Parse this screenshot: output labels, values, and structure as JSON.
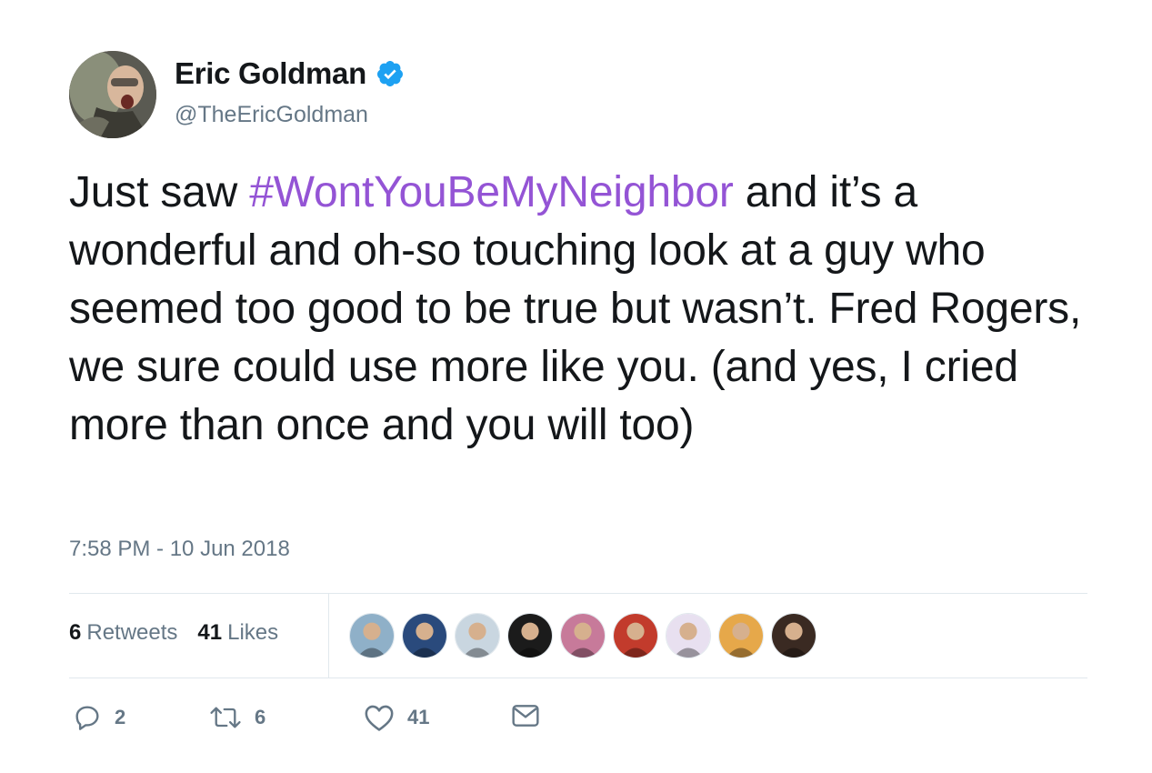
{
  "author": {
    "display_name": "Eric Goldman",
    "handle": "@TheEricGoldman",
    "verified": true,
    "avatar_icon": "user-avatar"
  },
  "tweet": {
    "text_before": "Just saw ",
    "hashtag": "#WontYouBeMyNeighbor",
    "text_after": " and it’s a wonderful and oh-so touching look at a guy who seemed too good to be true but wasn’t. Fred Rogers, we sure could use more like you. (and yes, I cried more than once and you will too)",
    "timestamp": "7:58 PM - 10 Jun 2018"
  },
  "stats": {
    "retweets_count": "6",
    "retweets_label": "Retweets",
    "likes_count": "41",
    "likes_label": "Likes"
  },
  "likers": [
    {
      "icon": "liker-avatar-1",
      "color": "#8fb0c8"
    },
    {
      "icon": "liker-avatar-2",
      "color": "#2a4a7c"
    },
    {
      "icon": "liker-avatar-3",
      "color": "#c9d6e0"
    },
    {
      "icon": "liker-avatar-4",
      "color": "#1b1b1b"
    },
    {
      "icon": "liker-avatar-5",
      "color": "#c77a9a"
    },
    {
      "icon": "liker-avatar-6",
      "color": "#c23b2c"
    },
    {
      "icon": "liker-avatar-7",
      "color": "#e8e0f0"
    },
    {
      "icon": "liker-avatar-8",
      "color": "#e6a84a"
    },
    {
      "icon": "liker-avatar-9",
      "color": "#3a2a22"
    }
  ],
  "actions": {
    "reply_count": "2",
    "retweet_count": "6",
    "like_count": "41"
  },
  "colors": {
    "hashtag": "#9454d5",
    "verified": "#1da1f2",
    "muted": "#657786",
    "divider": "#e1e8ed"
  }
}
